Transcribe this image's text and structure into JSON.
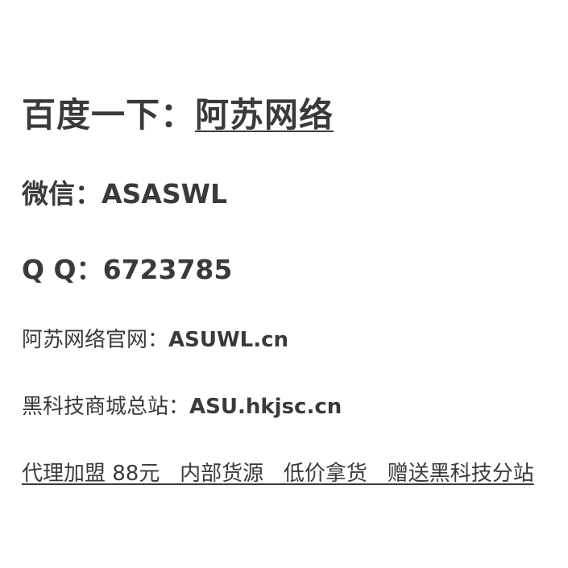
{
  "baidu": {
    "label": "百度一下：",
    "link": "阿苏网络"
  },
  "wechat": {
    "label": "微信：",
    "value": "ASASWL"
  },
  "qq": {
    "label": "Q Q：",
    "value": "6723785"
  },
  "official_site": {
    "label": "阿苏网络官网：",
    "value": "ASUWL.cn"
  },
  "main_store": {
    "label": "黑科技商城总站：",
    "value": "ASU.hkjsc.cn"
  },
  "promo_link": "代理加盟 88元   内部货源   低价拿货   赠送黑科技分站"
}
